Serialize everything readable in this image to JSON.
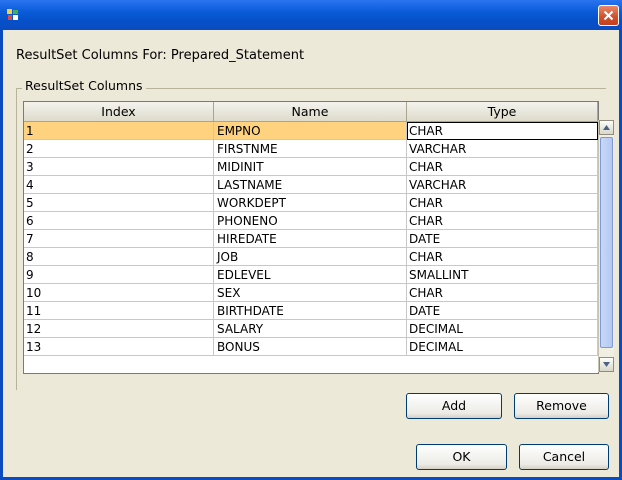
{
  "window": {
    "title": ""
  },
  "heading": {
    "text": "ResultSet Columns For:  Prepared_Statement"
  },
  "group": {
    "label": "ResultSet Columns"
  },
  "table": {
    "columns": [
      "Index",
      "Name",
      "Type"
    ],
    "rows": [
      {
        "index": "1",
        "name": "EMPNO",
        "type": "CHAR"
      },
      {
        "index": "2",
        "name": "FIRSTNME",
        "type": "VARCHAR"
      },
      {
        "index": "3",
        "name": "MIDINIT",
        "type": "CHAR"
      },
      {
        "index": "4",
        "name": "LASTNAME",
        "type": "VARCHAR"
      },
      {
        "index": "5",
        "name": "WORKDEPT",
        "type": "CHAR"
      },
      {
        "index": "6",
        "name": "PHONENO",
        "type": "CHAR"
      },
      {
        "index": "7",
        "name": "HIREDATE",
        "type": "DATE"
      },
      {
        "index": "8",
        "name": "JOB",
        "type": "CHAR"
      },
      {
        "index": "9",
        "name": "EDLEVEL",
        "type": "SMALLINT"
      },
      {
        "index": "10",
        "name": "SEX",
        "type": "CHAR"
      },
      {
        "index": "11",
        "name": "BIRTHDATE",
        "type": "DATE"
      },
      {
        "index": "12",
        "name": "SALARY",
        "type": "DECIMAL"
      },
      {
        "index": "13",
        "name": "BONUS",
        "type": "DECIMAL"
      }
    ],
    "selected_row": 0
  },
  "buttons": {
    "add": "Add",
    "remove": "Remove",
    "ok": "OK",
    "cancel": "Cancel"
  },
  "icons": {
    "app": "app-icon",
    "close": "close-icon",
    "scroll_up": "arrow-up-icon",
    "scroll_down": "arrow-down-icon"
  }
}
